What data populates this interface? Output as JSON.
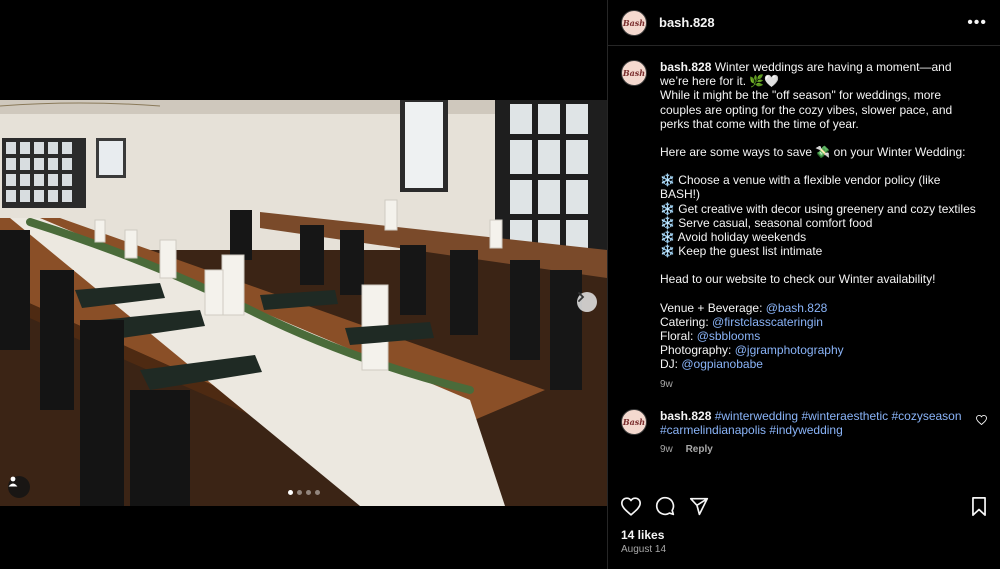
{
  "post": {
    "username": "bash.828",
    "avatar_text": "Bash",
    "more_icon": "more-horizontal-icon",
    "media": {
      "slide_count": 4,
      "current_slide": 1
    }
  },
  "caption": {
    "username": "bash.828",
    "lines": [
      "Winter weddings are having a moment—and we’re here for it. 🌿🤍",
      "",
      "While it might be the \"off season\" for weddings, more couples are opting for the cozy vibes, slower pace, and perks that come with the time of year.",
      "",
      "Here are some ways to save 💸 on your Winter Wedding:",
      "",
      "❄️ Choose a venue with a flexible vendor policy (like BASH!)",
      "❄️ Get creative with decor using greenery and cozy textiles",
      "❄️ Serve casual, seasonal comfort food",
      "❄️ Avoid holiday weekends",
      "❄️ Keep the guest list intimate",
      "",
      "Head to our website to check our Winter availability!",
      ""
    ],
    "credits": [
      {
        "label": "Venue + Beverage: ",
        "handle": "@bash.828"
      },
      {
        "label": "Catering: ",
        "handle": "@firstclasscateringin"
      },
      {
        "label": "Floral: ",
        "handle": "@sbblooms"
      },
      {
        "label": "Photography: ",
        "handle": "@jgramphotography"
      },
      {
        "label": "DJ: ",
        "handle": "@ogpianobabe"
      }
    ],
    "time": "9w"
  },
  "comment": {
    "username": "bash.828",
    "hashtags_line1": "#winterwedding #winteraesthetic #cozyseason",
    "hashtags_line2": "#carmelindianapolis #indywedding",
    "time": "9w",
    "reply_label": "Reply"
  },
  "footer": {
    "likes": "14 likes",
    "date": "August 14"
  },
  "colors": {
    "background": "#000000",
    "text": "#f5f5f5",
    "muted": "#a8a8a8",
    "link": "#8ab4f8",
    "divider": "#262626"
  }
}
